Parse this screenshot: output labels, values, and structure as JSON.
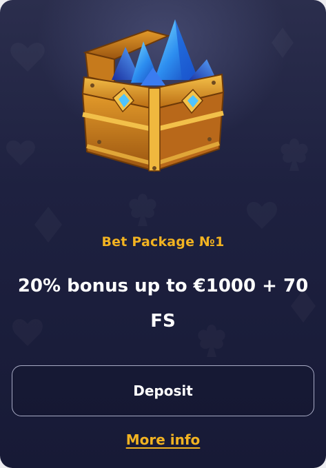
{
  "card": {
    "image_icon": "treasure-chest-with-blue-crystals",
    "title": "Bet Package №1",
    "offer": "20% bonus up to €1000 + 70 FS",
    "deposit_label": "Deposit",
    "more_info_label": "More info"
  },
  "colors": {
    "background": "#1e2140",
    "accent": "#f2b321",
    "text": "#ffffff",
    "button_border": "#a9acc6"
  }
}
